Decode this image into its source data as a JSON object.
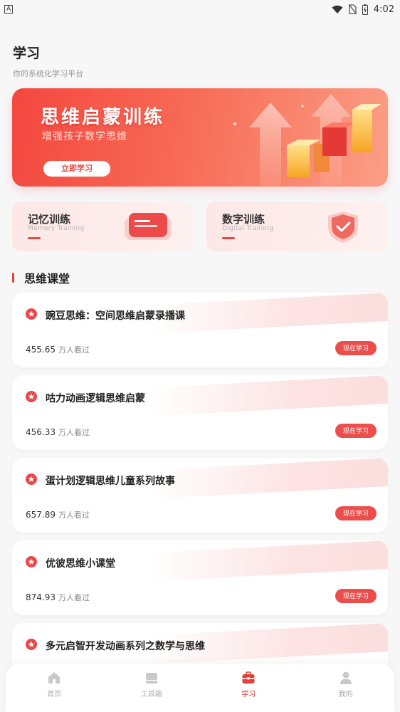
{
  "status_bar": {
    "indicator": "A",
    "time": "4:02",
    "icons": [
      "wifi-icon",
      "no-sim-icon",
      "battery-icon"
    ]
  },
  "header": {
    "title": "学习",
    "subtitle": "你的系统化学习平台"
  },
  "banner": {
    "title": "思维启蒙训练",
    "subtitle": "增强孩子数学思维",
    "button_label": "立即学习"
  },
  "training_cards": [
    {
      "title": "记忆训练",
      "subtitle": "Memory Training",
      "icon": "message-box-icon"
    },
    {
      "title": "数字训练",
      "subtitle": "Digital Training",
      "icon": "shield-check-icon"
    }
  ],
  "section": {
    "title": "思维课堂"
  },
  "courses": [
    {
      "name": "豌豆思维：空间思维启蒙录播课",
      "views": "455.65",
      "unit": "万人看过",
      "button": "现在学习"
    },
    {
      "name": "咕力动画逻辑思维启蒙",
      "views": "456.33",
      "unit": "万人看过",
      "button": "现在学习"
    },
    {
      "name": "蛋计划逻辑思维儿童系列故事",
      "views": "657.89",
      "unit": "万人看过",
      "button": "现在学习"
    },
    {
      "name": "优彼思维小课堂",
      "views": "874.93",
      "unit": "万人看过",
      "button": "现在学习"
    },
    {
      "name": "多元启智开发动画系列之数学与思维",
      "views": "",
      "unit": "",
      "button": ""
    }
  ],
  "tabs": [
    {
      "label": "首页",
      "icon": "home-icon",
      "active": false
    },
    {
      "label": "工具箱",
      "icon": "toolbox-icon",
      "active": false
    },
    {
      "label": "学习",
      "icon": "briefcase-icon",
      "active": true
    },
    {
      "label": "我的",
      "icon": "user-icon",
      "active": false
    }
  ],
  "colors": {
    "accent": "#e5403a",
    "background": "#f7f7f8",
    "banner_start": "#f4473f",
    "banner_end": "#fb9e86"
  }
}
